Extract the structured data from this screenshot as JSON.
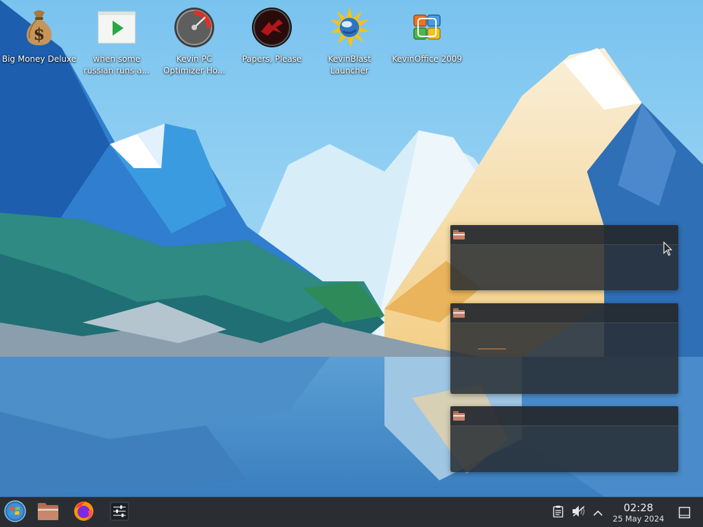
{
  "desktop": {
    "icons": [
      {
        "label": "Big Money Deluxe",
        "icon": "money-bag-icon"
      },
      {
        "label": "when some russian runs a...",
        "icon": "video-window-icon"
      },
      {
        "label": "Kevin PC Optimizer Ho...",
        "icon": "speedometer-icon"
      },
      {
        "label": "Papers, Please",
        "icon": "emblem-icon"
      },
      {
        "label": "KevinBlast Launcher",
        "icon": "sun-globe-icon"
      },
      {
        "label": "KevinOffice 2009",
        "icon": "office-logo-icon"
      }
    ]
  },
  "popups": [
    {
      "icon": "folder-icon",
      "title": ""
    },
    {
      "icon": "folder-icon",
      "title": ""
    },
    {
      "icon": "folder-icon",
      "title": ""
    }
  ],
  "taskbar": {
    "start": {
      "icon": "windows-start-orb-icon"
    },
    "pinned": [
      {
        "icon": "file-manager-icon"
      },
      {
        "icon": "firefox-icon"
      },
      {
        "icon": "mixer-settings-icon"
      }
    ],
    "tray": [
      {
        "icon": "clipboard-icon"
      },
      {
        "icon": "speaker-muted-icon"
      },
      {
        "icon": "chevron-up-icon"
      }
    ],
    "clock": {
      "time": "02:28",
      "date": "25 May 2024"
    },
    "show_desktop": {
      "icon": "show-desktop-icon"
    }
  },
  "colors": {
    "taskbar_bg": "#2a2e33",
    "popup_bg": "#282c32",
    "folder": "#c4826a",
    "sky": "#8fd3f4"
  }
}
